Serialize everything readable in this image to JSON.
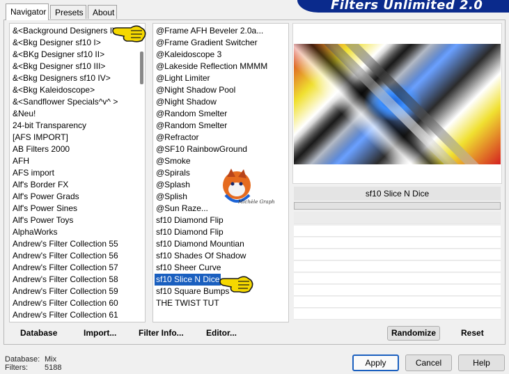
{
  "tabs": [
    {
      "label": "Navigator",
      "active": true
    },
    {
      "label": "Presets",
      "active": false
    },
    {
      "label": "About",
      "active": false
    }
  ],
  "title": "Filters Unlimited 2.0",
  "categories": [
    "&<Background Designers IV>",
    "&<Bkg Designer sf10 I>",
    "&<BKg Designer sf10 II>",
    "&<Bkg Designer sf10 III>",
    "&<Bkg Designers sf10 IV>",
    "&<Bkg Kaleidoscope>",
    "&<Sandflower Specials^v^ >",
    "&Neu!",
    "24-bit Transparency",
    "[AFS IMPORT]",
    "AB Filters 2000",
    "AFH",
    "AFS import",
    "Alf's Border FX",
    "Alf's Power Grads",
    "Alf's Power Sines",
    "Alf's Power Toys",
    "AlphaWorks",
    "Andrew's Filter Collection 55",
    "Andrew's Filter Collection 56",
    "Andrew's Filter Collection 57",
    "Andrew's Filter Collection 58",
    "Andrew's Filter Collection 59",
    "Andrew's Filter Collection 60",
    "Andrew's Filter Collection 61"
  ],
  "filters": [
    "@Frame AFH Beveler 2.0a...",
    "@Frame Gradient Switcher",
    "@Kaleidoscope 3",
    "@Lakeside Reflection MMMM",
    "@Light Limiter",
    "@Night Shadow Pool",
    "@Night Shadow",
    "@Random Smelter",
    "@Random Smelter",
    "@Refractor",
    "@SF10 RainbowGround",
    "@Smoke",
    "@Spirals",
    "@Splash",
    "@Splish",
    "@Sun Raze...",
    "sf10 Diamond Flip",
    "sf10 Diamond Flip",
    "sf10 Diamond Mountian",
    "sf10 Shades Of Shadow",
    "sf10 Sheer Curve",
    "sf10 Slice N Dice",
    "sf10 Square Bumps",
    "THE TWIST TUT"
  ],
  "selected_filter_index": 21,
  "selected_filter_name": "sf10 Slice N Dice",
  "watermark_text": "Michèle Graph",
  "left_buttons": {
    "database": "Database",
    "import": "Import...",
    "filter_info": "Filter Info...",
    "editor": "Editor..."
  },
  "right_buttons": {
    "randomize": "Randomize",
    "reset": "Reset"
  },
  "dialog_buttons": {
    "apply": "Apply",
    "cancel": "Cancel",
    "help": "Help"
  },
  "status": {
    "database_label": "Database:",
    "database_value": "Mix",
    "filters_label": "Filters:",
    "filters_value": "5188"
  },
  "colors": {
    "title_banner": "#0a2a8c",
    "selection": "#1a5fbf",
    "pointer_hand": "#f5d800"
  },
  "icons": [
    "pointing-hand-icon",
    "wolf-watermark-icon"
  ]
}
